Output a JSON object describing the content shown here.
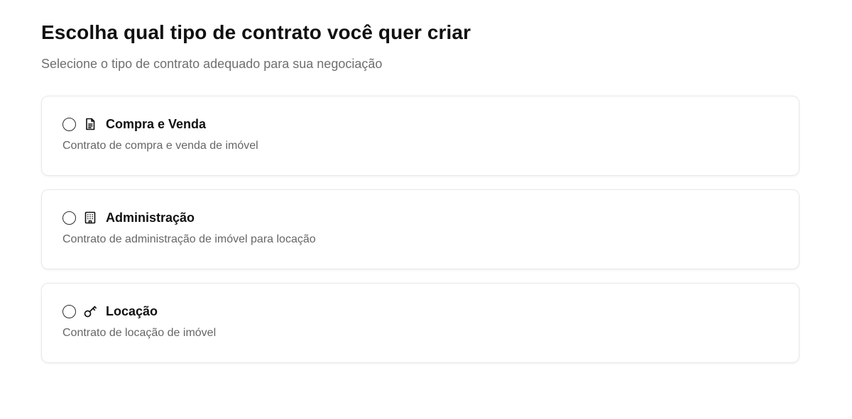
{
  "header": {
    "title": "Escolha qual tipo de contrato você quer criar",
    "subtitle": "Selecione o tipo de contrato adequado para sua negociação"
  },
  "options": [
    {
      "icon": "document-icon",
      "title": "Compra e Venda",
      "description": "Contrato de compra e venda de imóvel",
      "selected": false
    },
    {
      "icon": "building-icon",
      "title": "Administração",
      "description": "Contrato de administração de imóvel para locação",
      "selected": false
    },
    {
      "icon": "key-icon",
      "title": "Locação",
      "description": "Contrato de locação de imóvel",
      "selected": false
    }
  ]
}
